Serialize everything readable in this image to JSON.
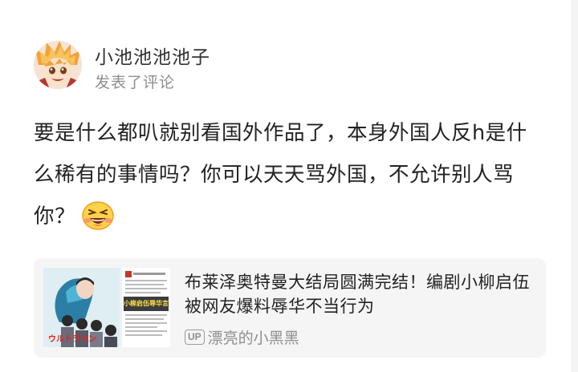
{
  "post": {
    "username": "小池池池池子",
    "action": "发表了评论",
    "content": "要是什么都叭就别看国外作品了，本身外国人反h是什么稀有的事情吗？你可以天天骂外国，不允许别人骂你？",
    "emoji_icon": "grinning-face-emoji"
  },
  "shared_video": {
    "title": "布莱泽奥特曼大结局圆满完结！编剧小柳启伍被网友爆料辱华不当行为",
    "up_badge": "UP",
    "author": "漂亮的小黑黑",
    "thumbnail_caption": "小柳启伍辱华言论"
  },
  "colors": {
    "username": "#333333",
    "secondary_text": "#8e8e8e",
    "card_background": "#f5f5f5"
  }
}
